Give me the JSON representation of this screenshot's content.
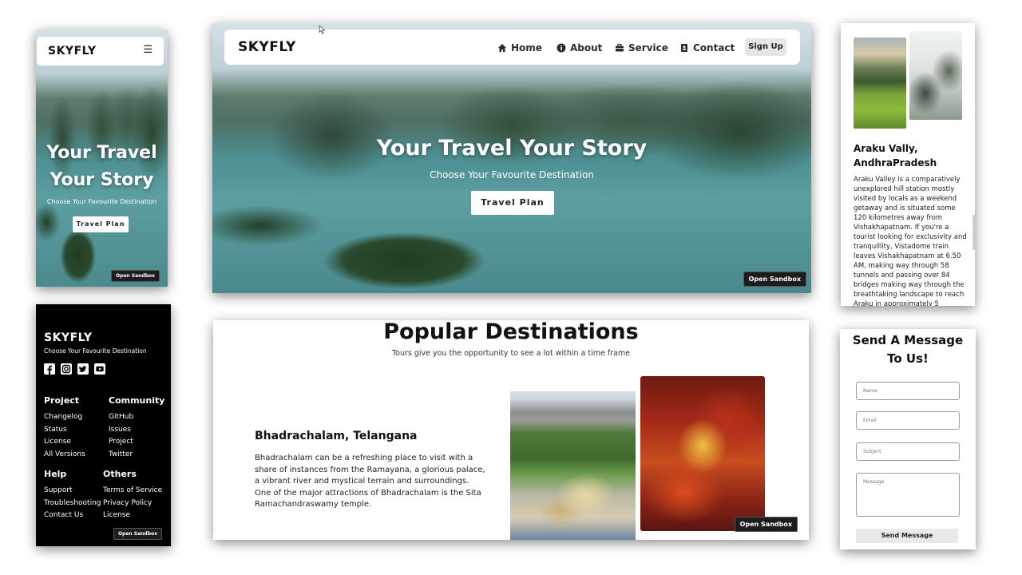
{
  "brand": "SKYFLY",
  "mobile_hero": {
    "title_line1": "Your Travel",
    "title_line2": "Your Story",
    "subtitle": "Choose Your Favourite Destination",
    "cta": "Travel Plan",
    "sandbox": "Open Sandbox",
    "menu_icon": "☰"
  },
  "desktop_hero": {
    "nav": {
      "home": "Home",
      "about": "About",
      "service": "Service",
      "contact": "Contact",
      "signup": "Sign Up"
    },
    "title": "Your Travel Your Story",
    "subtitle": "Choose Your Favourite Destination",
    "cta": "Travel Plan",
    "sandbox": "Open Sandbox"
  },
  "araku": {
    "title": "Araku Vally, AndhraPradesh",
    "body": "Araku Valley is a comparatively unexplored hill station mostly visited by locals as a weekend getaway and is situated some 120 kilometres away from Vishakhapatnam. If you're a tourist looking for exclusivity and tranquillity, Vistadome train leaves Vishakhapatnam at 6.50 AM, making way through 58 tunnels and passing over 84 bridges making way through the breathtaking landscape to reach Araku in approximately 5"
  },
  "footer": {
    "tagline": "Choose Your Favourite Destination",
    "social_icons": [
      "facebook-icon",
      "instagram-icon",
      "twitter-icon",
      "youtube-icon"
    ],
    "project": {
      "heading": "Project",
      "links": [
        "Changelog",
        "Status",
        "License",
        "All Versions"
      ]
    },
    "community": {
      "heading": "Community",
      "links": [
        "GitHub",
        "Issues",
        "Project",
        "Twitter"
      ]
    },
    "help": {
      "heading": "Help",
      "links": [
        "Support",
        "Troubleshooting",
        "Contact Us"
      ]
    },
    "others": {
      "heading": "Others",
      "links": [
        "Terms of Service",
        "Privacy Policy",
        "License"
      ]
    },
    "sandbox": "Open Sandbox"
  },
  "destinations": {
    "title": "Popular Destinations",
    "subtitle": "Tours give you the opportunity to see a lot within a time frame",
    "place_title": "Bhadrachalam, Telangana",
    "place_body": "Bhadrachalam can be a refreshing place to visit with a share of instances from the Ramayana, a glorious palace, a vibrant river and mystical terrain and surroundings. One of the major attractions of Bhadrachalam is the Sita Ramachandraswamy temple.",
    "sandbox": "Open Sandbox"
  },
  "contact_form": {
    "title_line1": "Send A Message",
    "title_line2": "To Us!",
    "name_placeholder": "Name",
    "email_placeholder": "Email",
    "subject_placeholder": "Subject",
    "message_placeholder": "Message",
    "submit": "Send Message"
  },
  "colors": {
    "brand_text": "#1a1a1a",
    "footer_bg": "#000000",
    "send_button_bg": "#e9e9e9"
  }
}
